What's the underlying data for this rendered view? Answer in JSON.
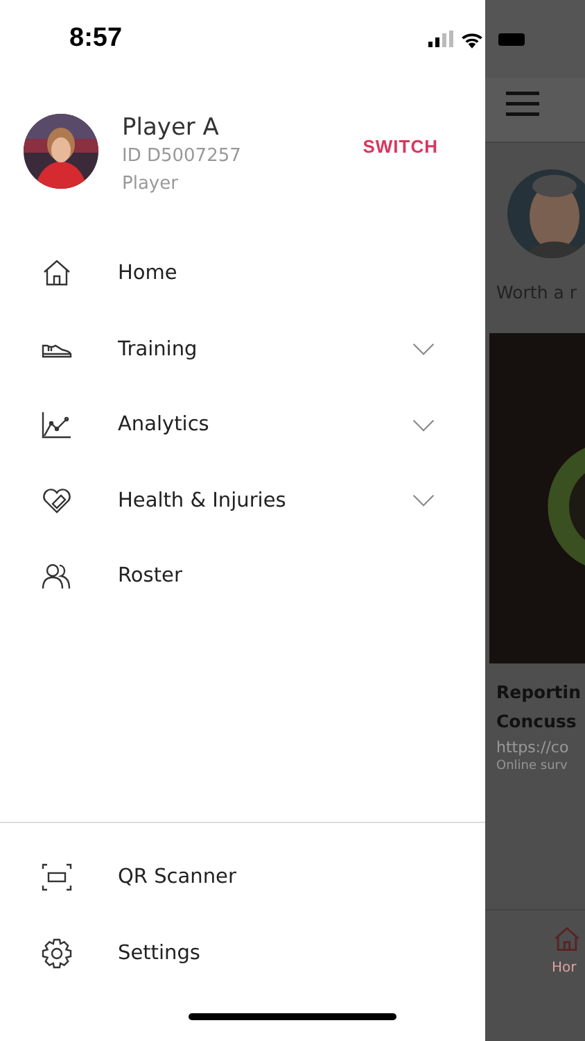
{
  "status_bar": {
    "time": "8:57"
  },
  "profile": {
    "name": "Player A",
    "id": "ID D5007257",
    "role": "Player",
    "switch": "SWITCH"
  },
  "menu": [
    {
      "label": "Home",
      "kind": "home",
      "expandable": false
    },
    {
      "label": "Training",
      "kind": "shoe",
      "expandable": true
    },
    {
      "label": "Analytics",
      "kind": "chart",
      "expandable": true
    },
    {
      "label": "Health & Injuries",
      "kind": "heart",
      "expandable": true
    },
    {
      "label": "Roster",
      "kind": "people",
      "expandable": false
    }
  ],
  "footer_menu": [
    {
      "label": "QR Scanner",
      "kind": "scan"
    },
    {
      "label": "Settings",
      "kind": "gear"
    }
  ],
  "background_page": {
    "post_text": "Worth a r",
    "card_title": [
      "Reportin",
      "Concuss"
    ],
    "card_url": "https://co",
    "card_source": "Online surv",
    "tab_label": "Hor"
  }
}
